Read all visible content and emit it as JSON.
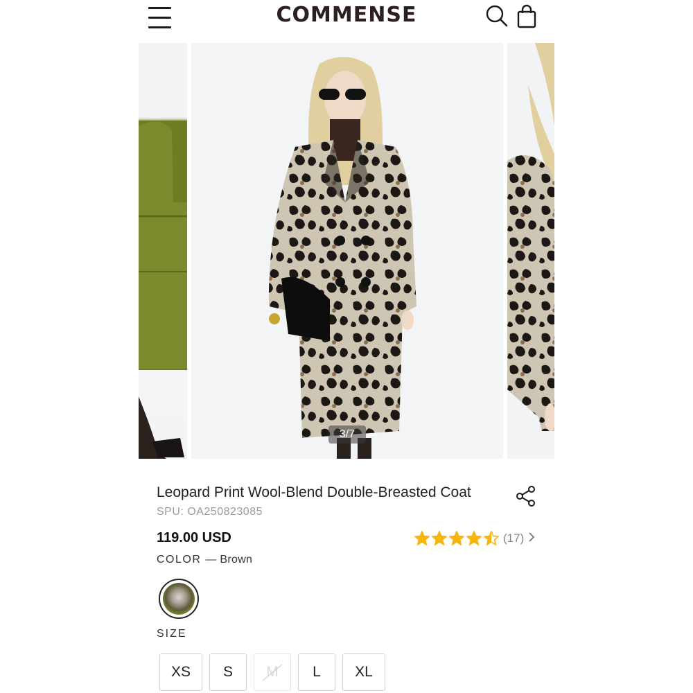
{
  "header": {
    "logo": "COMMENSE",
    "menu_icon": "hamburger-menu-icon",
    "search_icon": "search-icon",
    "bag_icon": "shopping-bag-icon"
  },
  "gallery": {
    "counter": "3/7"
  },
  "product": {
    "title": "Leopard Print Wool-Blend Double-Breasted Coat",
    "spu": "SPU: OA250823085",
    "price": "119.00 USD",
    "rating_value": 4.5,
    "rating_count": "(17)",
    "share_icon": "share-icon",
    "color_label": "COLOR",
    "color_value": "— Brown",
    "size_label": "SIZE",
    "sizes": [
      {
        "label": "XS",
        "available": true
      },
      {
        "label": "S",
        "available": true
      },
      {
        "label": "M",
        "available": false
      },
      {
        "label": "L",
        "available": true
      },
      {
        "label": "XL",
        "available": true
      }
    ]
  },
  "colors": {
    "star": "#f5b50a",
    "text": "#222222",
    "muted": "#9a9a9a",
    "logo": "#2b1f1f"
  }
}
